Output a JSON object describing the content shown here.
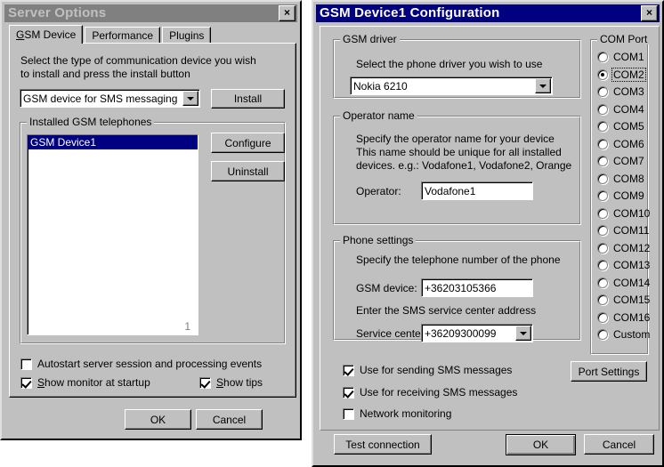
{
  "server_options": {
    "title": "Server Options",
    "close_label": "×",
    "tabs": [
      {
        "label": "GSM Device",
        "mnemonic": "G",
        "selected": true
      },
      {
        "label": "Performance",
        "selected": false
      },
      {
        "label": "Plugins",
        "selected": false
      }
    ],
    "instruction_line1": "Select the type of communication device you wish",
    "instruction_line2": "to install and press the install button",
    "device_combo": {
      "value": "GSM device for SMS messaging",
      "options": [
        "GSM device for SMS messaging"
      ]
    },
    "install_button": "Install",
    "installed_group_label": "Installed GSM telephones",
    "installed_devices": [
      {
        "name": "GSM Device1",
        "selected": true
      }
    ],
    "device_count": "1",
    "configure_button": "Configure",
    "uninstall_button": "Uninstall",
    "checkboxes": [
      {
        "label": "Autostart server session and processing events",
        "checked": false
      },
      {
        "label": "Show monitor at startup",
        "checked": true,
        "mnemonic": "S"
      },
      {
        "label": "Show tips",
        "checked": true,
        "mnemonic": "S"
      }
    ],
    "ok_button": "OK",
    "cancel_button": "Cancel"
  },
  "device_config": {
    "title": "GSM Device1 Configuration",
    "close_label": "×",
    "driver_group": {
      "label": "GSM driver",
      "instruction": "Select the phone driver you wish to use",
      "combo": {
        "value": "Nokia 6210",
        "options": [
          "Nokia 6210"
        ]
      }
    },
    "operator_group": {
      "label": "Operator name",
      "line1": "Specify the operator name for your device",
      "line2": "This name should be unique for all installed",
      "line3": "devices. e.g.: Vodafone1, Vodafone2, Orange",
      "field_label": "Operator:",
      "field_value": "Vodafone1"
    },
    "phone_group": {
      "label": "Phone settings",
      "line1": "Specify the telephone number of the phone",
      "gsm_label": "GSM device:",
      "gsm_value": "+36203105366",
      "line2": "Enter the SMS service center address",
      "sc_label": "Service center:",
      "sc_value": "+36209300099",
      "sc_options": [
        "+36209300099"
      ]
    },
    "com_group": {
      "label": "COM Port",
      "ports": [
        {
          "label": "COM1",
          "selected": false
        },
        {
          "label": "COM2",
          "selected": true,
          "focused": true
        },
        {
          "label": "COM3",
          "selected": false
        },
        {
          "label": "COM4",
          "selected": false
        },
        {
          "label": "COM5",
          "selected": false
        },
        {
          "label": "COM6",
          "selected": false
        },
        {
          "label": "COM7",
          "selected": false
        },
        {
          "label": "COM8",
          "selected": false
        },
        {
          "label": "COM9",
          "selected": false
        },
        {
          "label": "COM10",
          "selected": false
        },
        {
          "label": "COM11",
          "selected": false
        },
        {
          "label": "COM12",
          "selected": false
        },
        {
          "label": "COM13",
          "selected": false
        },
        {
          "label": "COM14",
          "selected": false
        },
        {
          "label": "COM15",
          "selected": false
        },
        {
          "label": "COM16",
          "selected": false
        },
        {
          "label": "Custom",
          "selected": false
        }
      ]
    },
    "checkboxes": [
      {
        "label": "Use for sending SMS messages",
        "checked": true
      },
      {
        "label": "Use for receiving SMS messages",
        "checked": true
      },
      {
        "label": "Network monitoring",
        "checked": false
      }
    ],
    "port_settings_button": "Port Settings",
    "test_connection_button": "Test connection",
    "ok_button": "OK",
    "cancel_button": "Cancel"
  },
  "colors": {
    "face": "#c0c0c0",
    "active_title": "#000080",
    "inactive_title": "#808080",
    "selection": "#000080",
    "window": "#ffffff",
    "gray_text": "#808080"
  }
}
